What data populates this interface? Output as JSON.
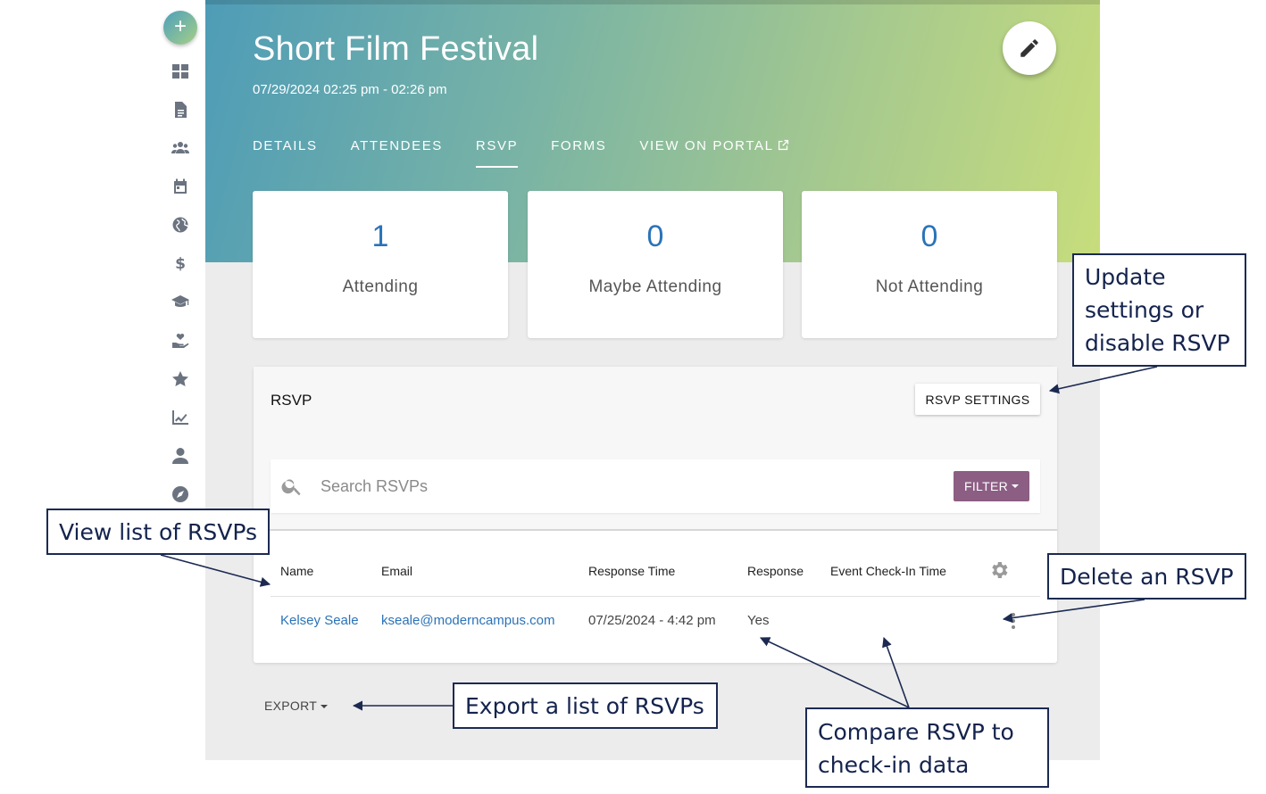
{
  "rail": {
    "add_label": "+",
    "icons": [
      "dashboard-icon",
      "document-icon",
      "groups-icon",
      "calendar-icon",
      "globe-icon",
      "dollar-icon",
      "graduation-cap-icon",
      "hand-heart-icon",
      "star-icon",
      "trending-chart-icon",
      "person-icon",
      "compass-icon"
    ]
  },
  "event": {
    "title": "Short Film Festival",
    "datetime": "07/29/2024 02:25 pm - 02:26 pm"
  },
  "tabs": [
    {
      "label": "DETAILS",
      "active": false
    },
    {
      "label": "ATTENDEES",
      "active": false
    },
    {
      "label": "RSVP",
      "active": true
    },
    {
      "label": "FORMS",
      "active": false
    },
    {
      "label": "VIEW ON PORTAL",
      "active": false
    }
  ],
  "stats": [
    {
      "value": "1",
      "label": "Attending"
    },
    {
      "value": "0",
      "label": "Maybe Attending"
    },
    {
      "value": "0",
      "label": "Not Attending"
    }
  ],
  "rsvp": {
    "title": "RSVP",
    "settings_button": "RSVP SETTINGS",
    "search_placeholder": "Search RSVPs",
    "filter_button": "FILTER",
    "columns": [
      "Name",
      "Email",
      "Response Time",
      "Response",
      "Event Check-In Time"
    ],
    "rows": [
      {
        "name": "Kelsey Seale",
        "email": "kseale@moderncampus.com",
        "response_time": "07/25/2024 - 4:42 pm",
        "response": "Yes",
        "checkin_time": ""
      }
    ],
    "export_button": "EXPORT"
  },
  "callouts": {
    "settings": "Update\nsettings or\ndisable RSVP",
    "view_list": "View list of RSVPs",
    "delete": "Delete an RSVP",
    "export": "Export a list of RSVPs",
    "compare": "Compare RSVP to\ncheck-in data"
  },
  "colors": {
    "accent_blue": "#2a73b8",
    "filter_purple": "#8c5e84",
    "callout_navy": "#1c2a52",
    "hero_gradient_start": "#4e9cb7",
    "hero_gradient_end": "#c7dd7c"
  }
}
